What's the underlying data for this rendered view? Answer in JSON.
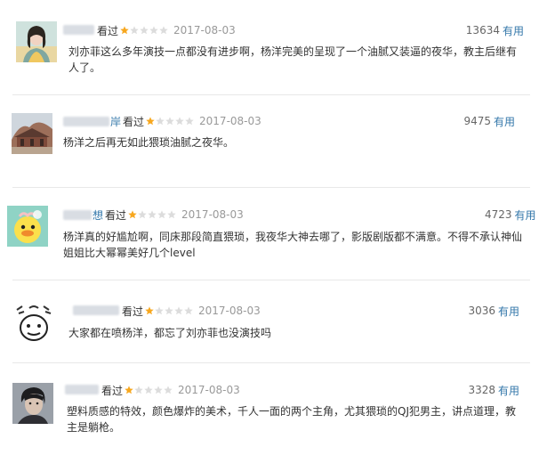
{
  "reviews": [
    {
      "user": "",
      "status": "看过",
      "rating": 1,
      "date": "2017-08-03",
      "votes": "13634",
      "useful_label": "有用",
      "text": "刘亦菲这么多年演技一点都没有进步啊，杨洋完美的呈现了一个油腻又装逼的夜华，教主后继有人了。",
      "avatar_icon": "woman-portrait-avatar"
    },
    {
      "user": "岸",
      "status": "看过",
      "rating": 1,
      "date": "2017-08-03",
      "votes": "9475",
      "useful_label": "有用",
      "text": "杨洋之后再无如此猥琐油腻之夜华。",
      "avatar_icon": "old-building-avatar"
    },
    {
      "user": "想",
      "status": "看过",
      "rating": 1,
      "date": "2017-08-03",
      "votes": "4723",
      "useful_label": "有用",
      "text": "杨洋真的好尴尬啊，同床那段简直猥琐，我夜华大神去哪了，影版剧版都不满意。不得不承认神仙姐姐比大幂幂美好几个level",
      "avatar_icon": "cartoon-duck-avatar"
    },
    {
      "user": "",
      "status": "看过",
      "rating": 1,
      "date": "2017-08-03",
      "votes": "3036",
      "useful_label": "有用",
      "text": "大家都在喷杨洋，都忘了刘亦菲也没演技吗",
      "avatar_icon": "doodle-face-avatar"
    },
    {
      "user": "",
      "status": "看过",
      "rating": 1,
      "date": "2017-08-03",
      "votes": "3328",
      "useful_label": "有用",
      "text": "塑料质感的特效，颜色爆炸的美术，千人一面的两个主角，尤其猥琐的QJ犯男主，讲点道理，教主是躺枪。",
      "avatar_icon": "man-portrait-avatar"
    }
  ],
  "colors": {
    "link": "#3377aa",
    "star_filled": "#f7a71e",
    "star_empty": "#dcdcdc",
    "date": "#999999",
    "divider": "#e8e8e8"
  }
}
